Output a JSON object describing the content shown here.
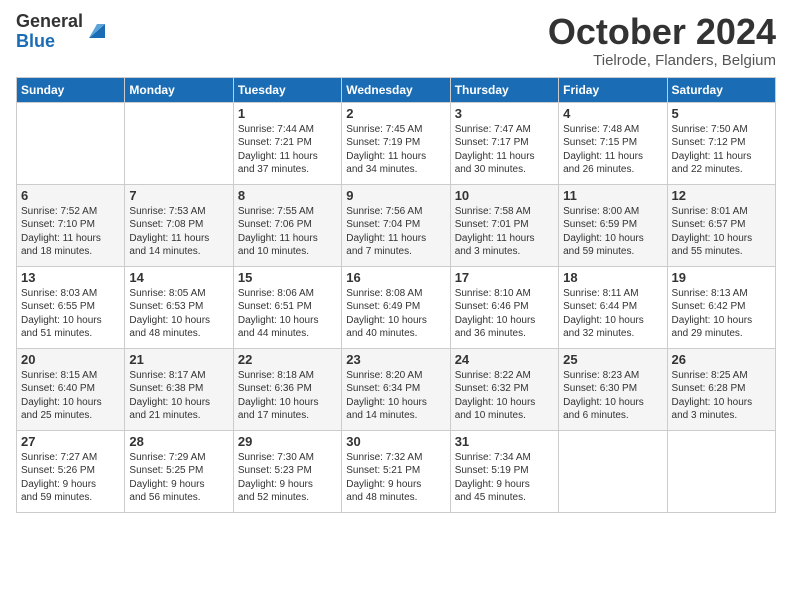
{
  "logo": {
    "general": "General",
    "blue": "Blue"
  },
  "header": {
    "month": "October 2024",
    "location": "Tielrode, Flanders, Belgium"
  },
  "days": [
    "Sunday",
    "Monday",
    "Tuesday",
    "Wednesday",
    "Thursday",
    "Friday",
    "Saturday"
  ],
  "weeks": [
    [
      {
        "num": "",
        "text": ""
      },
      {
        "num": "",
        "text": ""
      },
      {
        "num": "1",
        "text": "Sunrise: 7:44 AM\nSunset: 7:21 PM\nDaylight: 11 hours\nand 37 minutes."
      },
      {
        "num": "2",
        "text": "Sunrise: 7:45 AM\nSunset: 7:19 PM\nDaylight: 11 hours\nand 34 minutes."
      },
      {
        "num": "3",
        "text": "Sunrise: 7:47 AM\nSunset: 7:17 PM\nDaylight: 11 hours\nand 30 minutes."
      },
      {
        "num": "4",
        "text": "Sunrise: 7:48 AM\nSunset: 7:15 PM\nDaylight: 11 hours\nand 26 minutes."
      },
      {
        "num": "5",
        "text": "Sunrise: 7:50 AM\nSunset: 7:12 PM\nDaylight: 11 hours\nand 22 minutes."
      }
    ],
    [
      {
        "num": "6",
        "text": "Sunrise: 7:52 AM\nSunset: 7:10 PM\nDaylight: 11 hours\nand 18 minutes."
      },
      {
        "num": "7",
        "text": "Sunrise: 7:53 AM\nSunset: 7:08 PM\nDaylight: 11 hours\nand 14 minutes."
      },
      {
        "num": "8",
        "text": "Sunrise: 7:55 AM\nSunset: 7:06 PM\nDaylight: 11 hours\nand 10 minutes."
      },
      {
        "num": "9",
        "text": "Sunrise: 7:56 AM\nSunset: 7:04 PM\nDaylight: 11 hours\nand 7 minutes."
      },
      {
        "num": "10",
        "text": "Sunrise: 7:58 AM\nSunset: 7:01 PM\nDaylight: 11 hours\nand 3 minutes."
      },
      {
        "num": "11",
        "text": "Sunrise: 8:00 AM\nSunset: 6:59 PM\nDaylight: 10 hours\nand 59 minutes."
      },
      {
        "num": "12",
        "text": "Sunrise: 8:01 AM\nSunset: 6:57 PM\nDaylight: 10 hours\nand 55 minutes."
      }
    ],
    [
      {
        "num": "13",
        "text": "Sunrise: 8:03 AM\nSunset: 6:55 PM\nDaylight: 10 hours\nand 51 minutes."
      },
      {
        "num": "14",
        "text": "Sunrise: 8:05 AM\nSunset: 6:53 PM\nDaylight: 10 hours\nand 48 minutes."
      },
      {
        "num": "15",
        "text": "Sunrise: 8:06 AM\nSunset: 6:51 PM\nDaylight: 10 hours\nand 44 minutes."
      },
      {
        "num": "16",
        "text": "Sunrise: 8:08 AM\nSunset: 6:49 PM\nDaylight: 10 hours\nand 40 minutes."
      },
      {
        "num": "17",
        "text": "Sunrise: 8:10 AM\nSunset: 6:46 PM\nDaylight: 10 hours\nand 36 minutes."
      },
      {
        "num": "18",
        "text": "Sunrise: 8:11 AM\nSunset: 6:44 PM\nDaylight: 10 hours\nand 32 minutes."
      },
      {
        "num": "19",
        "text": "Sunrise: 8:13 AM\nSunset: 6:42 PM\nDaylight: 10 hours\nand 29 minutes."
      }
    ],
    [
      {
        "num": "20",
        "text": "Sunrise: 8:15 AM\nSunset: 6:40 PM\nDaylight: 10 hours\nand 25 minutes."
      },
      {
        "num": "21",
        "text": "Sunrise: 8:17 AM\nSunset: 6:38 PM\nDaylight: 10 hours\nand 21 minutes."
      },
      {
        "num": "22",
        "text": "Sunrise: 8:18 AM\nSunset: 6:36 PM\nDaylight: 10 hours\nand 17 minutes."
      },
      {
        "num": "23",
        "text": "Sunrise: 8:20 AM\nSunset: 6:34 PM\nDaylight: 10 hours\nand 14 minutes."
      },
      {
        "num": "24",
        "text": "Sunrise: 8:22 AM\nSunset: 6:32 PM\nDaylight: 10 hours\nand 10 minutes."
      },
      {
        "num": "25",
        "text": "Sunrise: 8:23 AM\nSunset: 6:30 PM\nDaylight: 10 hours\nand 6 minutes."
      },
      {
        "num": "26",
        "text": "Sunrise: 8:25 AM\nSunset: 6:28 PM\nDaylight: 10 hours\nand 3 minutes."
      }
    ],
    [
      {
        "num": "27",
        "text": "Sunrise: 7:27 AM\nSunset: 5:26 PM\nDaylight: 9 hours\nand 59 minutes."
      },
      {
        "num": "28",
        "text": "Sunrise: 7:29 AM\nSunset: 5:25 PM\nDaylight: 9 hours\nand 56 minutes."
      },
      {
        "num": "29",
        "text": "Sunrise: 7:30 AM\nSunset: 5:23 PM\nDaylight: 9 hours\nand 52 minutes."
      },
      {
        "num": "30",
        "text": "Sunrise: 7:32 AM\nSunset: 5:21 PM\nDaylight: 9 hours\nand 48 minutes."
      },
      {
        "num": "31",
        "text": "Sunrise: 7:34 AM\nSunset: 5:19 PM\nDaylight: 9 hours\nand 45 minutes."
      },
      {
        "num": "",
        "text": ""
      },
      {
        "num": "",
        "text": ""
      }
    ]
  ]
}
